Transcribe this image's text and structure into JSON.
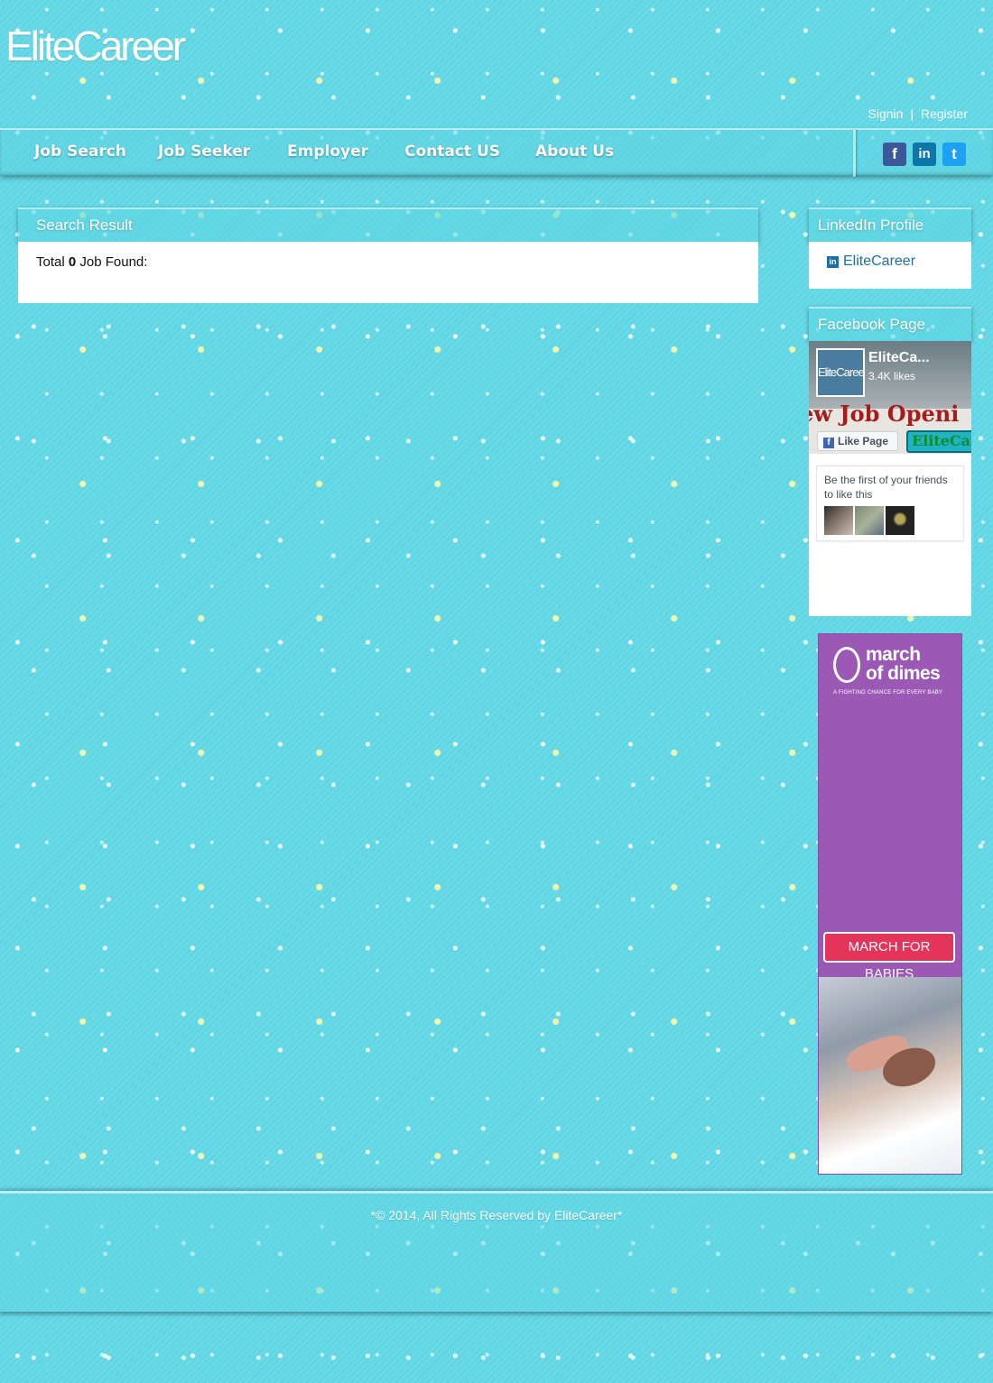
{
  "header": {
    "logo": "EliteCareer",
    "signin": "Signin",
    "separator": "|",
    "register": "Register"
  },
  "nav": {
    "items": [
      "Job Search",
      "Job Seeker",
      "Employer",
      "Contact US",
      "About Us"
    ],
    "social": [
      {
        "name": "facebook-icon",
        "glyph": "f",
        "color": "#3b5998"
      },
      {
        "name": "linkedin-icon",
        "glyph": "in",
        "color": "#0e76a8"
      },
      {
        "name": "twitter-icon",
        "glyph": "t",
        "color": "#1da1f2"
      }
    ]
  },
  "search": {
    "title": "Search Result",
    "total_prefix": "Total",
    "count": "0",
    "total_suffix": "Job Found:"
  },
  "linkedin": {
    "title": "LinkedIn Profile",
    "link_text": "EliteCareer",
    "link_color": "#1c6ea4"
  },
  "facebook": {
    "title": "Facebook Page",
    "page_name": "EliteCa...",
    "likes": "3.4K likes",
    "avatar_text": "EliteCareer",
    "banner_text": "ew Job Openi",
    "like_button": "Like Page",
    "tag_text": "EliteCar",
    "friends_text": "Be the first of your friends to like this"
  },
  "ad": {
    "brand_line1": "march",
    "brand_line2": "of dimes",
    "tagline": "A FIGHTING CHANCE FOR EVERY BABY",
    "button": "MARCH FOR BABIES",
    "bg_color": "#9b58b5"
  },
  "footer": {
    "text": "*© 2014, All Rights Reserved by EliteCareer*"
  },
  "colors": {
    "background": "#5fd6e3",
    "panel": "#ffffff",
    "text": "#111111"
  }
}
